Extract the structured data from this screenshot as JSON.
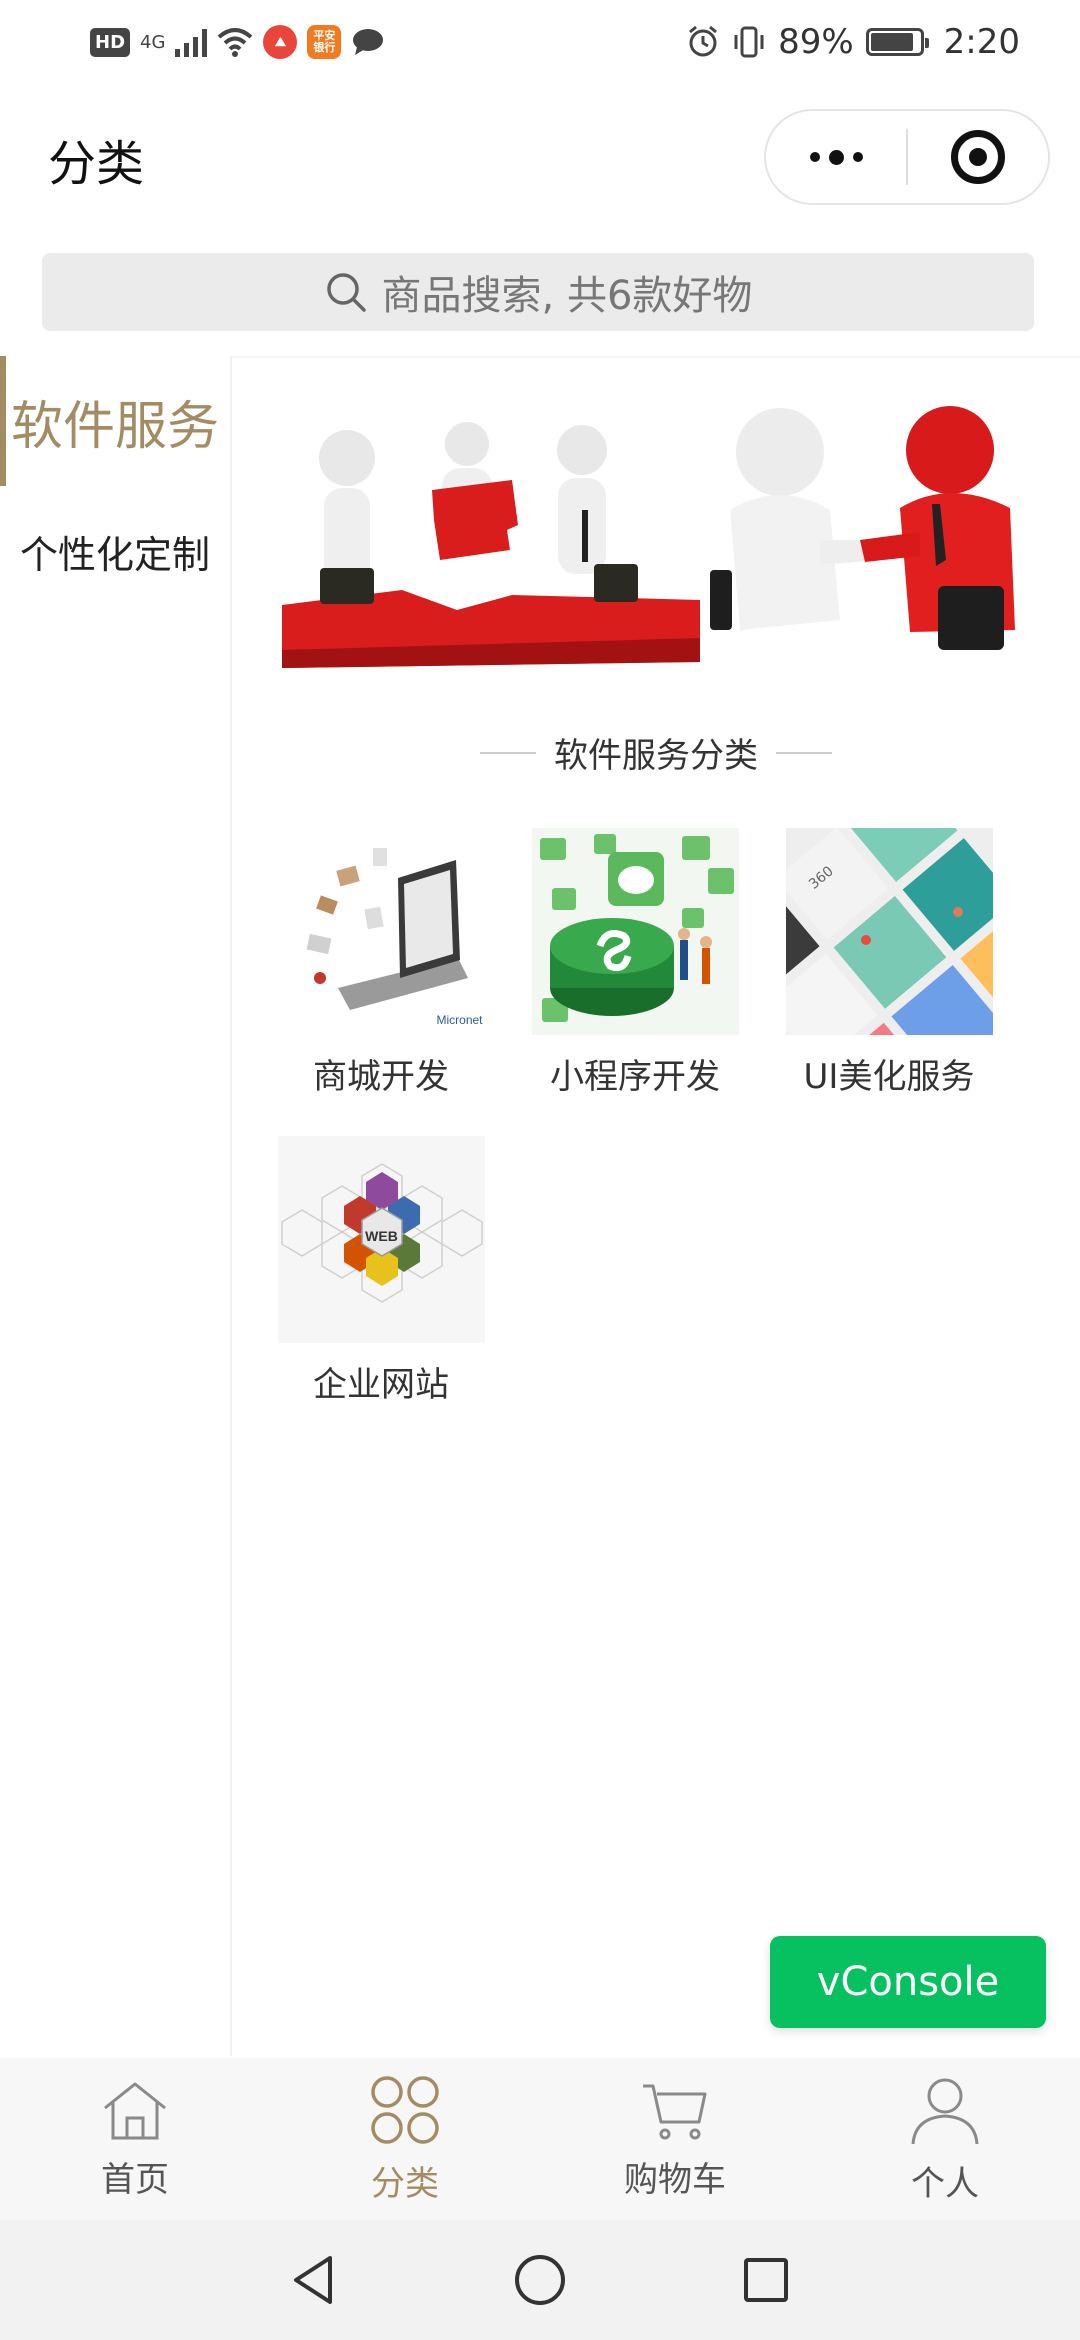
{
  "status_bar": {
    "hd": "HD",
    "network": "4G",
    "app_badge_text": "平安银行",
    "battery": "89%",
    "time": "2:20"
  },
  "header": {
    "title": "分类"
  },
  "search": {
    "placeholder": "商品搜索, 共6款好物"
  },
  "sidebar": {
    "items": [
      {
        "label": "软件服务",
        "active": true
      },
      {
        "label": "个性化定制",
        "active": false
      }
    ]
  },
  "main": {
    "section_title": "软件服务分类",
    "items": [
      {
        "label": "商城开发",
        "image_caption": "Micronet"
      },
      {
        "label": "小程序开发"
      },
      {
        "label": "UI美化服务",
        "image_text": "360"
      },
      {
        "label": "企业网站",
        "image_text": "WEB"
      }
    ]
  },
  "vconsole_label": "vConsole",
  "tabbar": {
    "items": [
      {
        "label": "首页",
        "icon": "home-icon",
        "active": false
      },
      {
        "label": "分类",
        "icon": "category-icon",
        "active": true
      },
      {
        "label": "购物车",
        "icon": "cart-icon",
        "active": false
      },
      {
        "label": "个人",
        "icon": "person-icon",
        "active": false
      }
    ]
  },
  "colors": {
    "accent": "#a38c63",
    "vconsole": "#07c160"
  }
}
